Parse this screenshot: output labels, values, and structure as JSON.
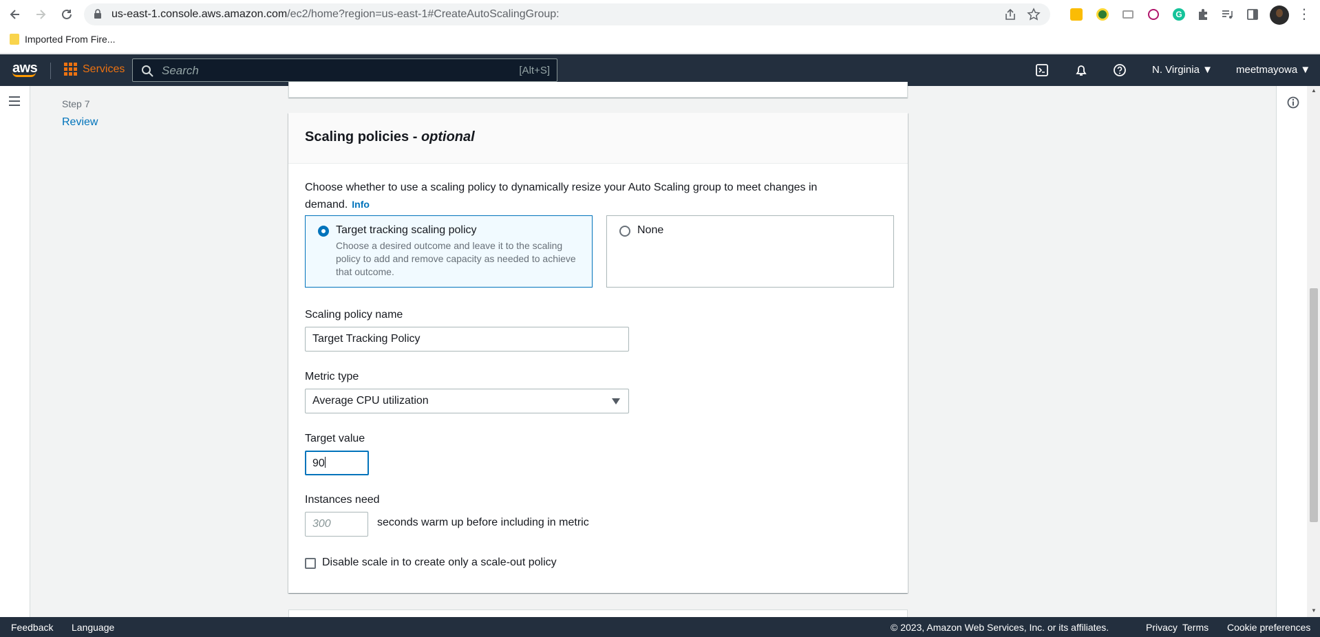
{
  "browser": {
    "url_host": "us-east-1.console.aws.amazon.com",
    "url_path": "/ec2/home?region=us-east-1#CreateAutoScalingGroup:",
    "bookmark": "Imported From Fire..."
  },
  "aws_nav": {
    "logo": "aws",
    "services": "Services",
    "search_placeholder": "Search",
    "search_shortcut": "[Alt+S]",
    "region": "N. Virginia ▼",
    "user": "meetmayowa ▼"
  },
  "steps": {
    "step_number": "Step 7",
    "step_label": "Review"
  },
  "section": {
    "title": "Scaling policies - ",
    "title_suffix": "optional",
    "description": "Choose whether to use a scaling policy to dynamically resize your Auto Scaling group to meet changes in demand.",
    "info": "Info"
  },
  "options": {
    "target_tracking": {
      "label": "Target tracking scaling policy",
      "description": "Choose a desired outcome and leave it to the scaling policy to add and remove capacity as needed to achieve that outcome.",
      "selected": true
    },
    "none": {
      "label": "None",
      "selected": false
    }
  },
  "form": {
    "policy_name_label": "Scaling policy name",
    "policy_name_value": "Target Tracking Policy",
    "metric_type_label": "Metric type",
    "metric_type_value": "Average CPU utilization",
    "target_value_label": "Target value",
    "target_value": "90",
    "instances_need_label": "Instances need",
    "warmup_placeholder": "300",
    "warmup_suffix": "seconds warm up before including in metric",
    "disable_scale_in_label": "Disable scale in to create only a scale-out policy",
    "disable_scale_in_checked": false
  },
  "footer": {
    "feedback": "Feedback",
    "language": "Language",
    "copyright": "© 2023, Amazon Web Services, Inc. or its affiliates.",
    "privacy": "Privacy",
    "terms": "Terms",
    "cookies": "Cookie preferences"
  },
  "colors": {
    "aws_nav_bg": "#232f3e",
    "aws_orange": "#ec7211",
    "link_blue": "#0073bb"
  }
}
